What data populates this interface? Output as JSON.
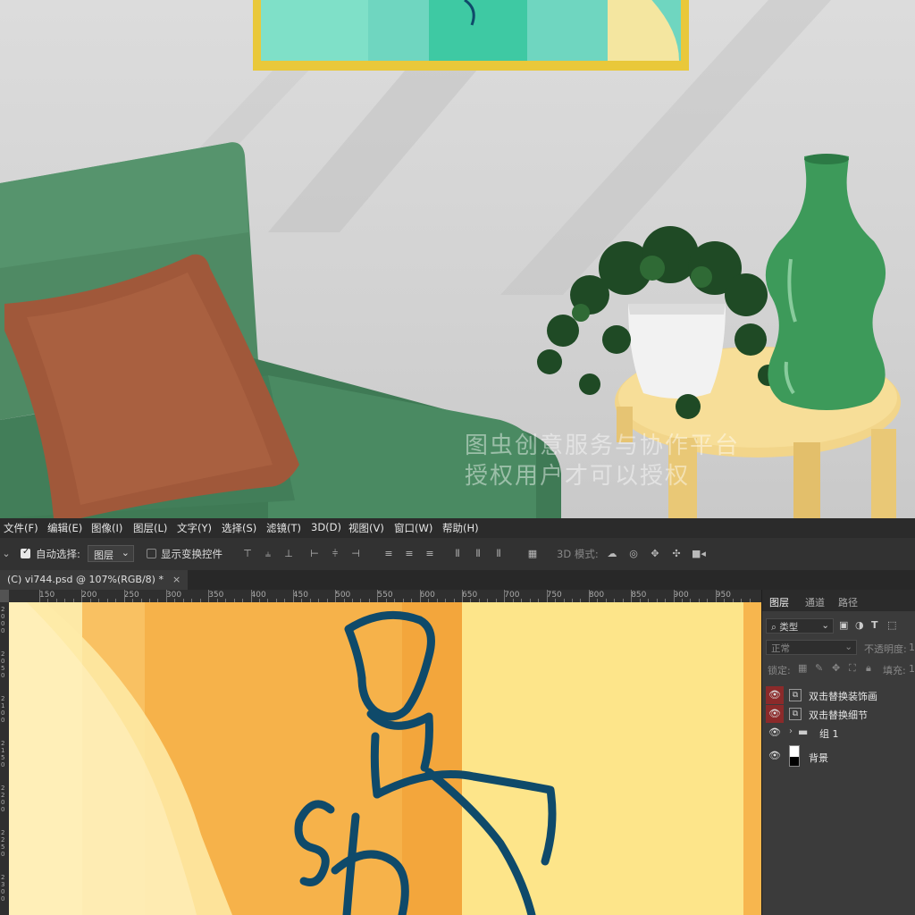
{
  "watermark": {
    "line1": "图虫创意服务与协作平台",
    "line2": "授权用户才可以授权"
  },
  "menu": [
    "文件(F)",
    "编辑(E)",
    "图像(I)",
    "图层(L)",
    "文字(Y)",
    "选择(S)",
    "滤镜(T)",
    "3D(D)",
    "视图(V)",
    "窗口(W)",
    "帮助(H)"
  ],
  "options": {
    "auto_select_label": "自动选择:",
    "auto_select_value": "图层",
    "transform_label": "显示变换控件",
    "mode_3d_label": "3D 模式:"
  },
  "document_tab": {
    "title": "(C) vi744.psd @ 107%(RGB/8) *",
    "close": "×"
  },
  "ruler": {
    "h_labels": [
      "150",
      "200",
      "250",
      "300",
      "350",
      "400",
      "450",
      "500",
      "550",
      "600",
      "650",
      "700",
      "750",
      "800",
      "850",
      "900",
      "950"
    ],
    "v_labels": [
      "2000",
      "2050",
      "2100",
      "2150",
      "2200",
      "2250",
      "2300"
    ]
  },
  "layers_panel": {
    "tabs": [
      "图层",
      "通道",
      "路径"
    ],
    "active_tab": "图层",
    "filter_kind": "类型",
    "blend_mode": "正常",
    "opacity_label": "不透明度:",
    "opacity_value": "1",
    "lock_label": "锁定:",
    "fill_label": "填充:",
    "fill_value": "1",
    "layers": [
      {
        "name": "双击替换装饰画",
        "visible": true,
        "highlighted": true,
        "type": "smart-object"
      },
      {
        "name": "双击替换细节",
        "visible": true,
        "highlighted": true,
        "type": "smart-object"
      },
      {
        "name": "组 1",
        "visible": true,
        "highlighted": false,
        "type": "group"
      },
      {
        "name": "背景",
        "visible": true,
        "highlighted": false,
        "type": "background"
      }
    ]
  },
  "colors": {
    "sofa_green": "#4f8a64",
    "pillow_brown": "#a0583a",
    "vase_green": "#3d9a5a",
    "table_yellow": "#f2d58a",
    "frame_gold": "#e8c53a",
    "canvas_orange": "#f6b24a",
    "canvas_yellow": "#fde58a",
    "canvas_line": "#0f4a6a"
  }
}
